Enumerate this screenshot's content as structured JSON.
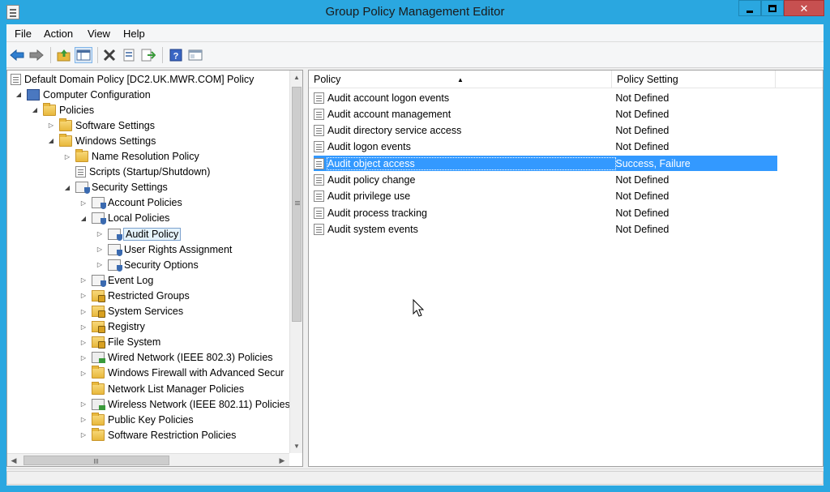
{
  "window": {
    "title": "Group Policy Management Editor",
    "minimize_label": "",
    "close_label": "✕"
  },
  "menu": [
    "File",
    "Action",
    "View",
    "Help"
  ],
  "toolbar": {
    "icons": [
      "back-arrow-icon",
      "forward-arrow-icon",
      "up-folder-icon",
      "show-hide-tree-icon",
      "delete-icon",
      "properties-icon",
      "export-list-icon",
      "help-icon",
      "console-tree-icon"
    ]
  },
  "tree": {
    "items": [
      {
        "label": "Default Domain Policy [DC2.UK.MWR.COM] Policy",
        "level": 0,
        "toggle": "",
        "icon": "policy-doc"
      },
      {
        "label": "Computer Configuration",
        "level": 1,
        "toggle": "◢",
        "icon": "computer"
      },
      {
        "label": "Policies",
        "level": 2,
        "toggle": "◢",
        "icon": "folder"
      },
      {
        "label": "Software Settings",
        "level": 3,
        "toggle": "▷",
        "icon": "folder"
      },
      {
        "label": "Windows Settings",
        "level": 3,
        "toggle": "◢",
        "icon": "folder"
      },
      {
        "label": "Name Resolution Policy",
        "level": 4,
        "toggle": "▷",
        "icon": "folder"
      },
      {
        "label": "Scripts (Startup/Shutdown)",
        "level": 4,
        "toggle": "",
        "icon": "policy-doc"
      },
      {
        "label": "Security Settings",
        "level": 4,
        "toggle": "◢",
        "icon": "secdoc"
      },
      {
        "label": "Account Policies",
        "level": 5,
        "toggle": "▷",
        "icon": "secdoc"
      },
      {
        "label": "Local Policies",
        "level": 5,
        "toggle": "◢",
        "icon": "secdoc"
      },
      {
        "label": "Audit Policy",
        "level": 6,
        "toggle": "▷",
        "icon": "secdoc",
        "selected": true
      },
      {
        "label": "User Rights Assignment",
        "level": 6,
        "toggle": "▷",
        "icon": "secdoc"
      },
      {
        "label": "Security Options",
        "level": 6,
        "toggle": "▷",
        "icon": "secdoc"
      },
      {
        "label": "Event Log",
        "level": 5,
        "toggle": "▷",
        "icon": "secdoc"
      },
      {
        "label": "Restricted Groups",
        "level": 5,
        "toggle": "▷",
        "icon": "lockfolder"
      },
      {
        "label": "System Services",
        "level": 5,
        "toggle": "▷",
        "icon": "lockfolder"
      },
      {
        "label": "Registry",
        "level": 5,
        "toggle": "▷",
        "icon": "lockfolder"
      },
      {
        "label": "File System",
        "level": 5,
        "toggle": "▷",
        "icon": "lockfolder"
      },
      {
        "label": "Wired Network (IEEE 802.3) Policies",
        "level": 5,
        "toggle": "▷",
        "icon": "netgreen"
      },
      {
        "label": "Windows Firewall with Advanced Secur",
        "level": 5,
        "toggle": "▷",
        "icon": "folder"
      },
      {
        "label": "Network List Manager Policies",
        "level": 5,
        "toggle": "",
        "icon": "folder"
      },
      {
        "label": "Wireless Network (IEEE 802.11) Policies",
        "level": 5,
        "toggle": "▷",
        "icon": "netgreen"
      },
      {
        "label": "Public Key Policies",
        "level": 5,
        "toggle": "▷",
        "icon": "folder"
      },
      {
        "label": "Software Restriction Policies",
        "level": 5,
        "toggle": "▷",
        "icon": "folder"
      }
    ]
  },
  "list": {
    "columns": [
      "Policy",
      "Policy Setting"
    ],
    "rows": [
      {
        "policy": "Audit account logon events",
        "setting": "Not Defined"
      },
      {
        "policy": "Audit account management",
        "setting": "Not Defined"
      },
      {
        "policy": "Audit directory service access",
        "setting": "Not Defined"
      },
      {
        "policy": "Audit logon events",
        "setting": "Not Defined"
      },
      {
        "policy": "Audit object access",
        "setting": "Success, Failure",
        "selected": true
      },
      {
        "policy": "Audit policy change",
        "setting": "Not Defined"
      },
      {
        "policy": "Audit privilege use",
        "setting": "Not Defined"
      },
      {
        "policy": "Audit process tracking",
        "setting": "Not Defined"
      },
      {
        "policy": "Audit system events",
        "setting": "Not Defined"
      }
    ]
  },
  "scroll": {
    "up": "▲",
    "down": "▼",
    "left": "◀",
    "right": "▶"
  },
  "colors": {
    "titlebar": "#2aa7e0",
    "selection": "#3399ff",
    "close": "#c75050"
  }
}
